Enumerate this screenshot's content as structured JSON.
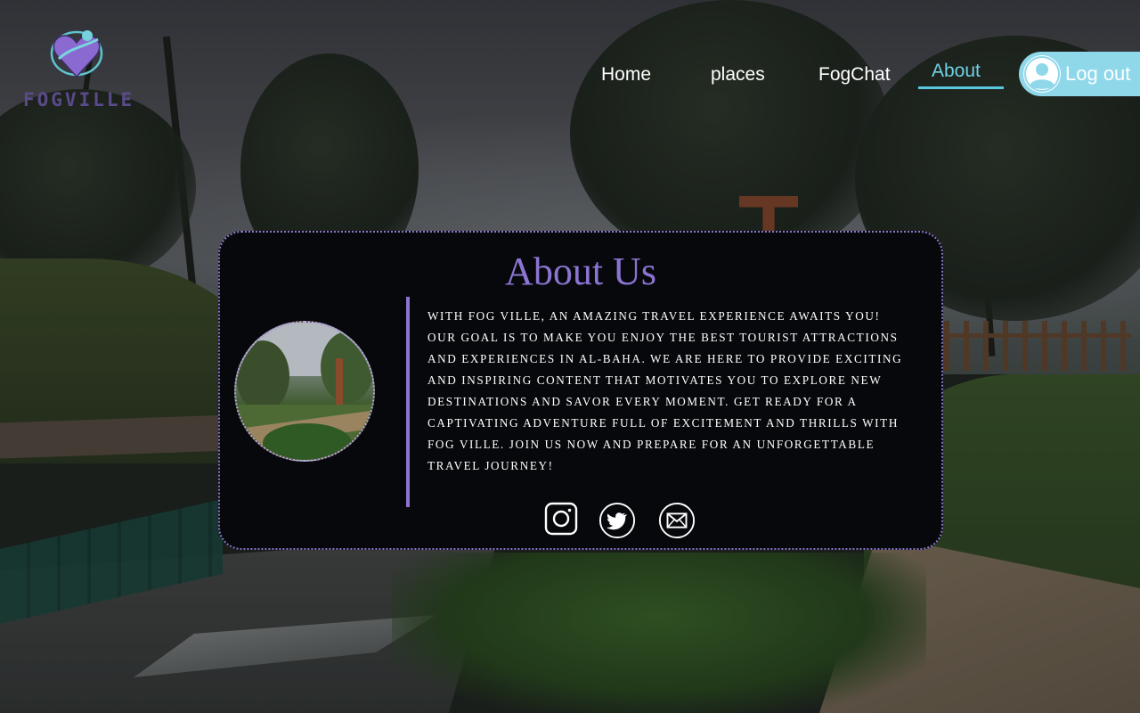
{
  "brand": {
    "name": "FOGVILLE"
  },
  "nav": {
    "links": [
      {
        "label": "Home",
        "active": false
      },
      {
        "label": "places",
        "active": false
      },
      {
        "label": "FogChat",
        "active": false
      },
      {
        "label": "About",
        "active": true
      }
    ],
    "logout_label": "Log out",
    "avatar_icon": "user-avatar-icon"
  },
  "about": {
    "title": "About Us",
    "body": "With Fog Ville, an amazing travel experience awaits you! Our goal is to make you enjoy the best tourist attractions and experiences in Al-Baha. We are here to provide exciting and inspiring content that motivates you to explore new destinations and savor every moment. Get ready for a captivating adventure full of excitement and thrills with Fog Ville. Join us now and prepare for an unforgettable travel journey!",
    "social": [
      {
        "icon": "instagram-icon"
      },
      {
        "icon": "twitter-icon"
      },
      {
        "icon": "mail-icon"
      }
    ]
  },
  "colors": {
    "accent_purple": "#8b74d2",
    "accent_cyan": "#58c8df",
    "card_background": "#07080b",
    "logout_background": "#8fd8ea"
  }
}
